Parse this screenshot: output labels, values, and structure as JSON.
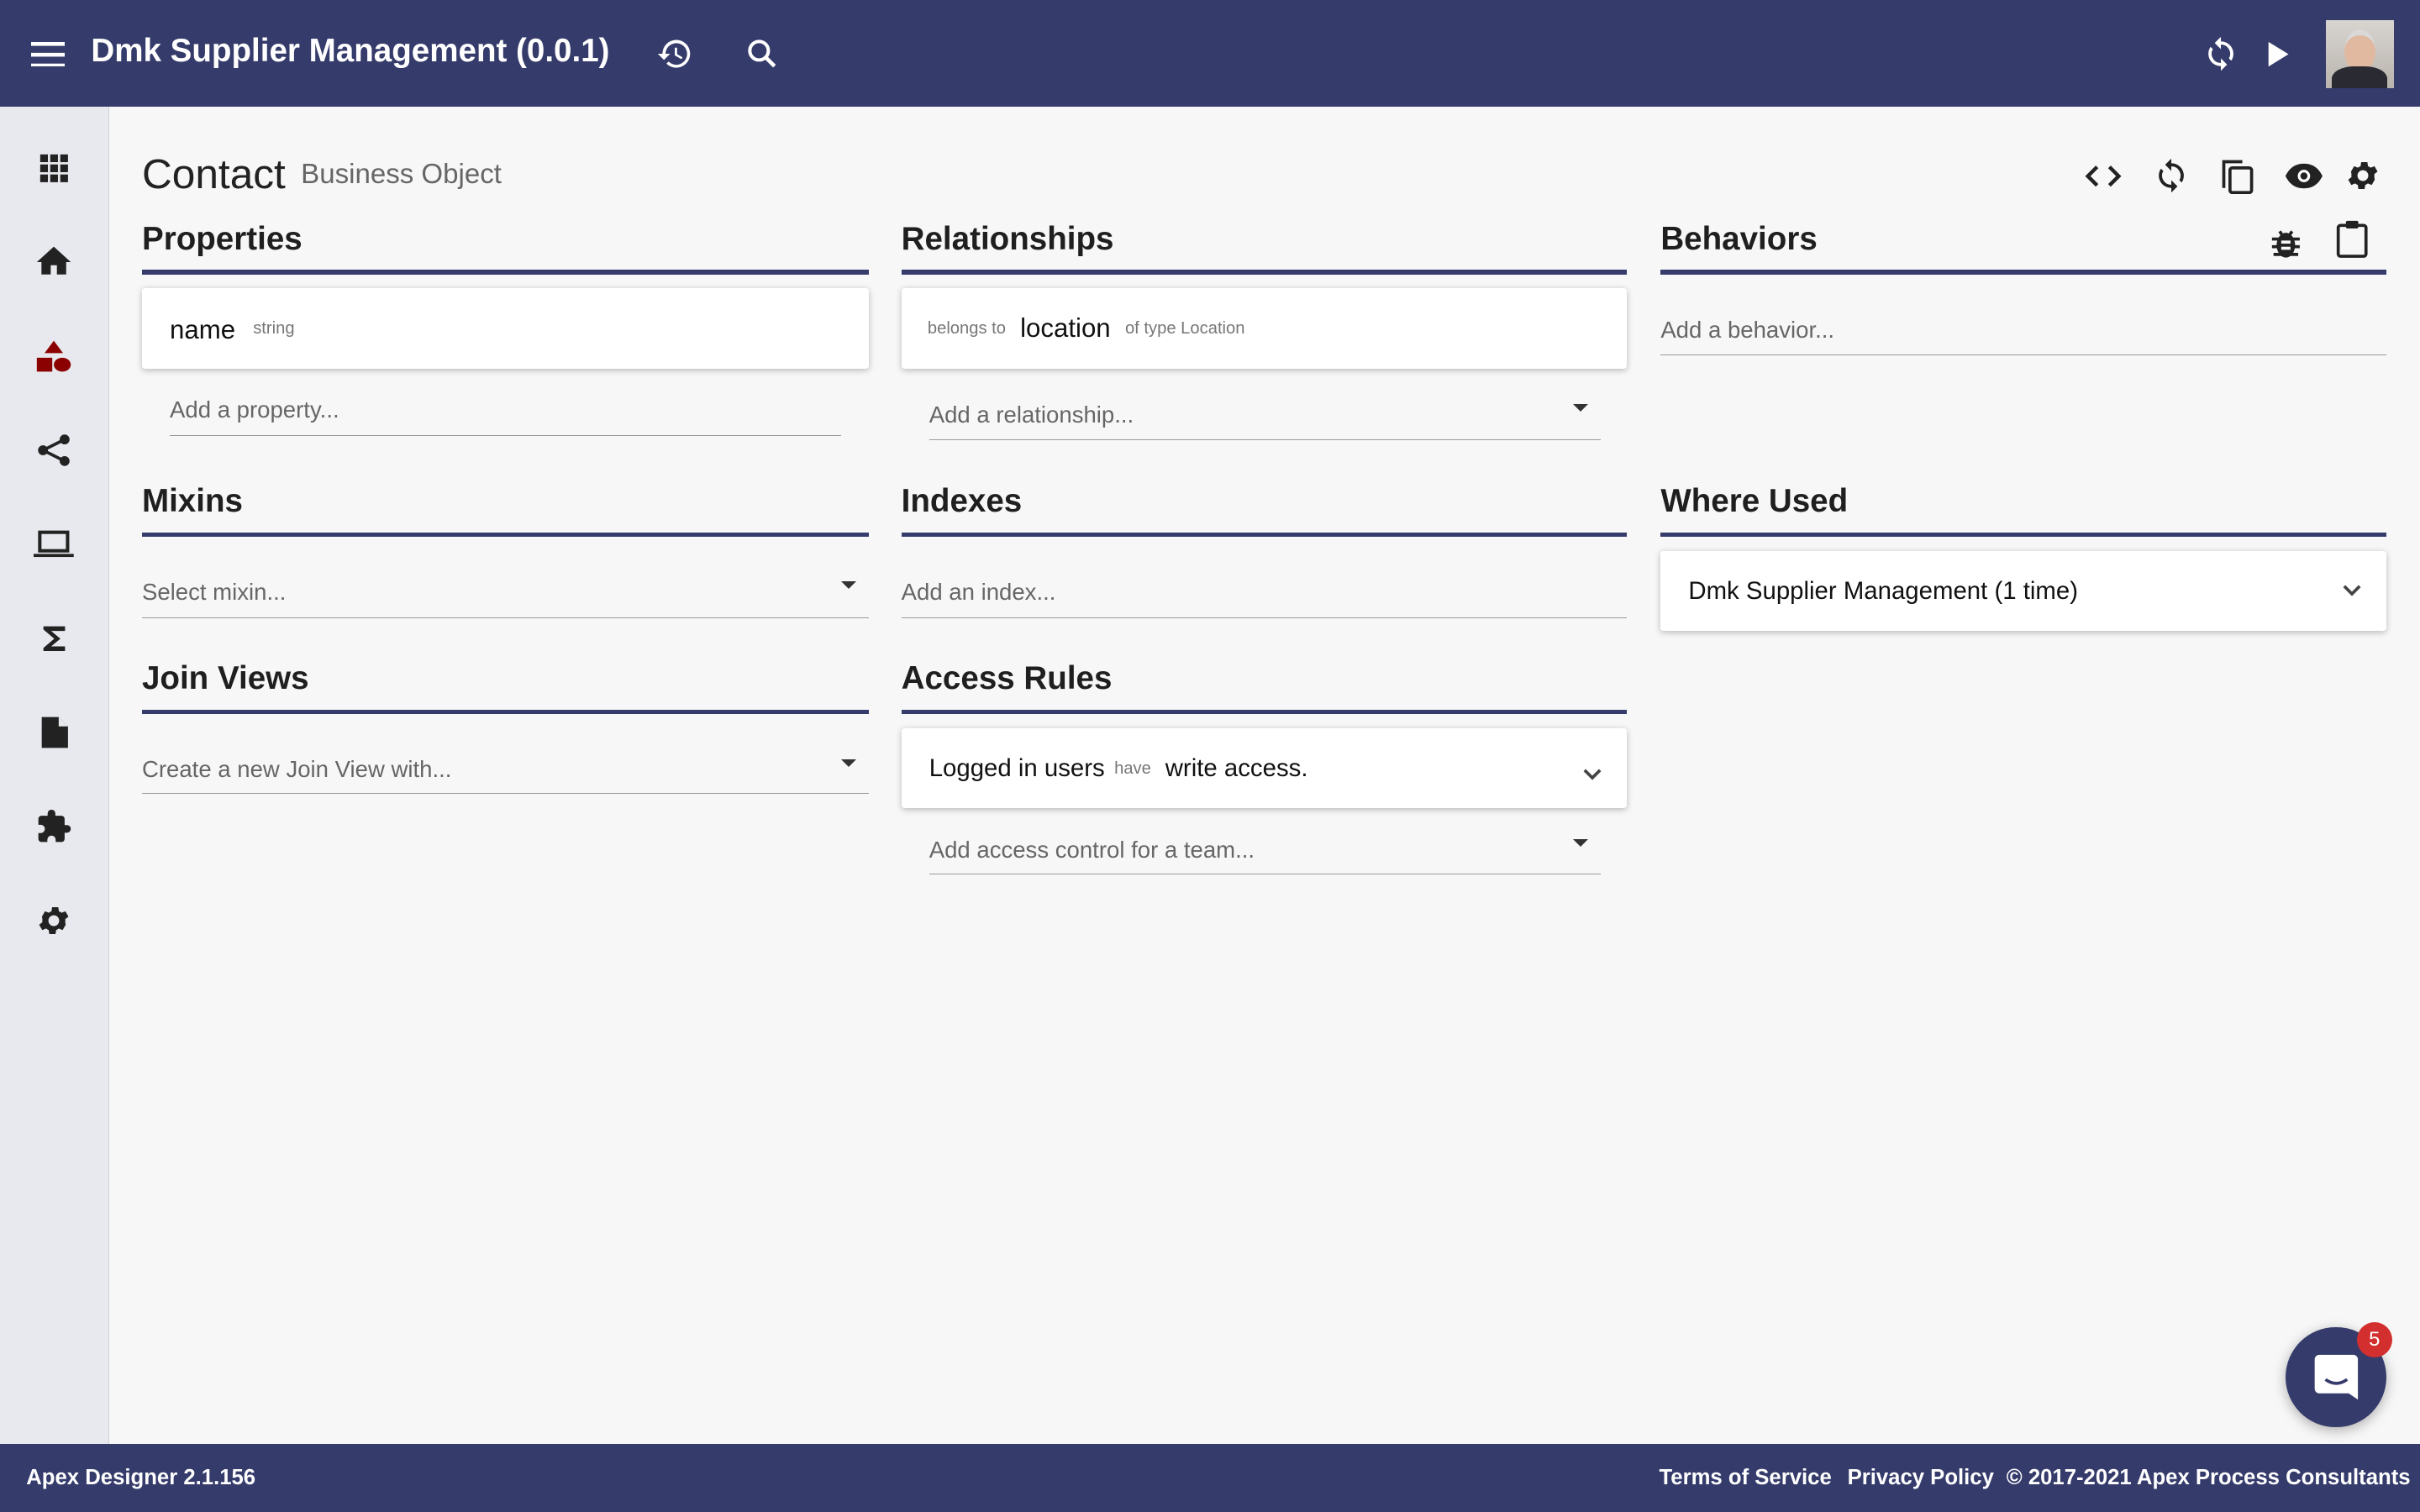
{
  "header": {
    "title": "Dmk Supplier Management (0.0.1)",
    "icons": [
      "menu-icon",
      "history-icon",
      "search-icon",
      "sync-icon",
      "play-icon",
      "avatar"
    ]
  },
  "sidebar": {
    "items": [
      "apps-icon",
      "home-icon",
      "business-objects-icon",
      "relationships-icon",
      "user-interfaces-icon",
      "sigma-icon",
      "document-icon",
      "extension-icon",
      "settings-icon"
    ],
    "active_color": "#8b0000"
  },
  "page": {
    "title": "Contact",
    "subtitle": "Business Object",
    "toolbar_icons": [
      "code-icon",
      "sync-icon",
      "copy-icon",
      "eye-icon",
      "gear-icon"
    ]
  },
  "properties": {
    "title": "Properties",
    "items": [
      {
        "name": "name",
        "type": "string"
      }
    ],
    "add_placeholder": "Add a property..."
  },
  "relationships": {
    "title": "Relationships",
    "items": [
      {
        "prefix": "belongs to",
        "name": "location",
        "suffix": "of type Location"
      }
    ],
    "add_placeholder": "Add a relationship..."
  },
  "behaviors": {
    "title": "Behaviors",
    "add_placeholder": "Add a behavior..."
  },
  "mixins": {
    "title": "Mixins",
    "placeholder": "Select mixin..."
  },
  "indexes": {
    "title": "Indexes",
    "placeholder": "Add an index..."
  },
  "where_used": {
    "title": "Where Used",
    "items": [
      "Dmk Supplier Management (1 time)"
    ]
  },
  "join_views": {
    "title": "Join Views",
    "placeholder": "Create a new Join View with..."
  },
  "access_rules": {
    "title": "Access Rules",
    "rule": {
      "who": "Logged in users",
      "verb": "have",
      "access": "write access."
    },
    "add_placeholder": "Add access control for a team..."
  },
  "chat": {
    "badge": "5"
  },
  "footer": {
    "version": "Apex Designer 2.1.156",
    "terms": "Terms of Service",
    "privacy": "Privacy Policy",
    "copyright": "© 2017-2021 Apex Process Consultants"
  },
  "colors": {
    "primary": "#353b6b",
    "background": "#f7f7f7",
    "badge": "#d32f2f"
  }
}
